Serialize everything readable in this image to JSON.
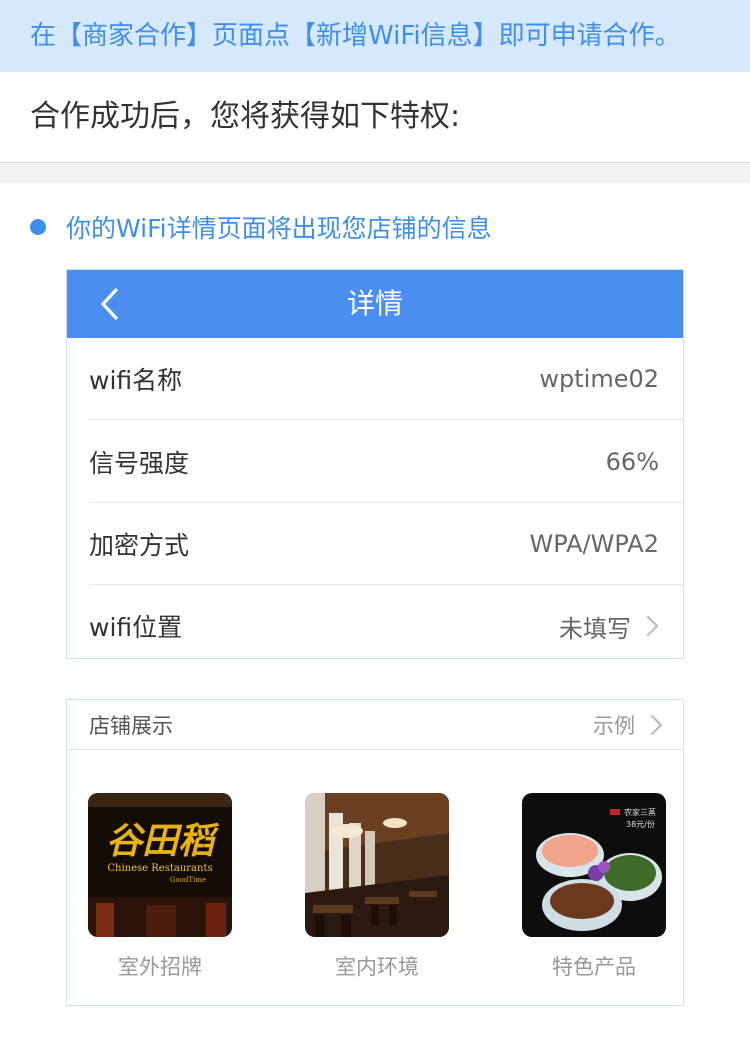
{
  "notice": "在【商家合作】页面点【新增WiFi信息】即可申请合作。",
  "intro": "合作成功后，您将获得如下特权:",
  "benefit": "你的WiFi详情页面将出现您店铺的信息",
  "detail": {
    "title": "详情",
    "rows": [
      {
        "label": "wifi名称",
        "value": "wptime02"
      },
      {
        "label": "信号强度",
        "value": "66%"
      },
      {
        "label": "加密方式",
        "value": "WPA/WPA2"
      },
      {
        "label": "wifi位置",
        "value": "未填写"
      }
    ]
  },
  "shop": {
    "title": "店铺展示",
    "example": "示例",
    "items": [
      {
        "caption": "室外招牌",
        "sign_cn": "谷田稻",
        "sign_en": "Chinese Restaurants",
        "sign_sub": "GoodTime"
      },
      {
        "caption": "室内环境"
      },
      {
        "caption": "特色产品",
        "menu_title": "农家三蒸",
        "menu_price": "38元/份"
      }
    ]
  },
  "colors": {
    "accent": "#3d8fe9",
    "header": "#4a8ff0",
    "notice_bg": "#d6e8fb"
  }
}
